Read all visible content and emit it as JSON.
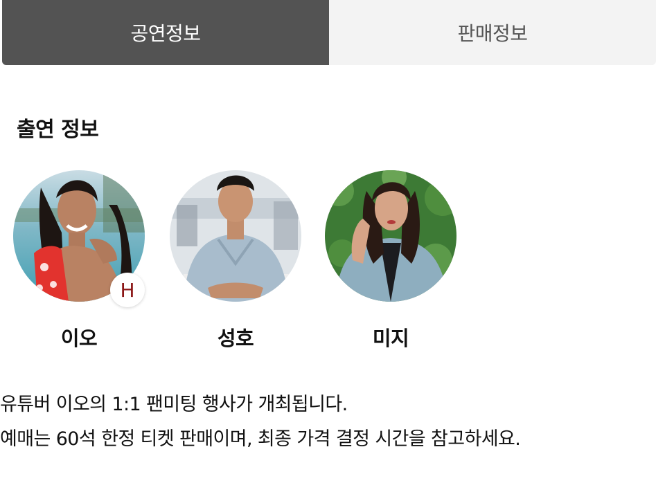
{
  "tabs": [
    {
      "label": "공연정보",
      "active": true
    },
    {
      "label": "판매정보",
      "active": false
    }
  ],
  "section": {
    "title": "출연 정보"
  },
  "cast": [
    {
      "name": "이오",
      "badge": "H"
    },
    {
      "name": "성호"
    },
    {
      "name": "미지"
    }
  ],
  "description": {
    "line1": "유튜버 이오의 1:1 팬미팅 행사가 개최됩니다.",
    "line2": "예매는 60석 한정 티켓 판매이며, 최종 가격 결정 시간을 참고하세요."
  },
  "colors": {
    "active_tab_bg": "#535353",
    "inactive_tab_bg": "#f3f3f3",
    "badge_text": "#8b1616"
  }
}
